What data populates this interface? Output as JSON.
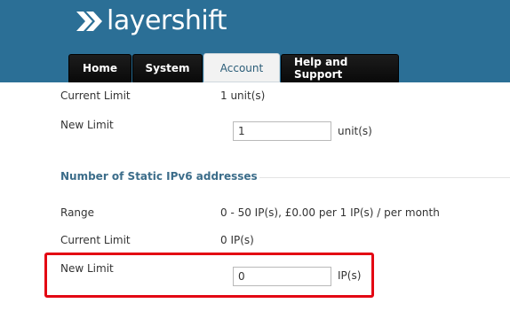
{
  "header": {
    "logo_text": "layershift",
    "colors": {
      "bar": "#2b6f96",
      "tab_active_text": "#2b5d78",
      "highlight": "#e30613"
    }
  },
  "nav": {
    "tabs": [
      {
        "label": "Home",
        "active": false
      },
      {
        "label": "System",
        "active": false
      },
      {
        "label": "Account",
        "active": true
      },
      {
        "label": "Help and Support",
        "active": false
      }
    ]
  },
  "units_section": {
    "current_limit_label": "Current Limit",
    "current_limit_value": "1 unit(s)",
    "new_limit_label": "New Limit",
    "new_limit_value": "1",
    "new_limit_unit": "unit(s)"
  },
  "ipv6_section": {
    "title": "Number of Static IPv6 addresses",
    "range_label": "Range",
    "range_value": "0 - 50 IP(s), £0.00 per 1 IP(s) / per month",
    "current_limit_label": "Current Limit",
    "current_limit_value": "0 IP(s)",
    "new_limit_label": "New Limit",
    "new_limit_value": "0",
    "new_limit_unit": "IP(s)"
  }
}
